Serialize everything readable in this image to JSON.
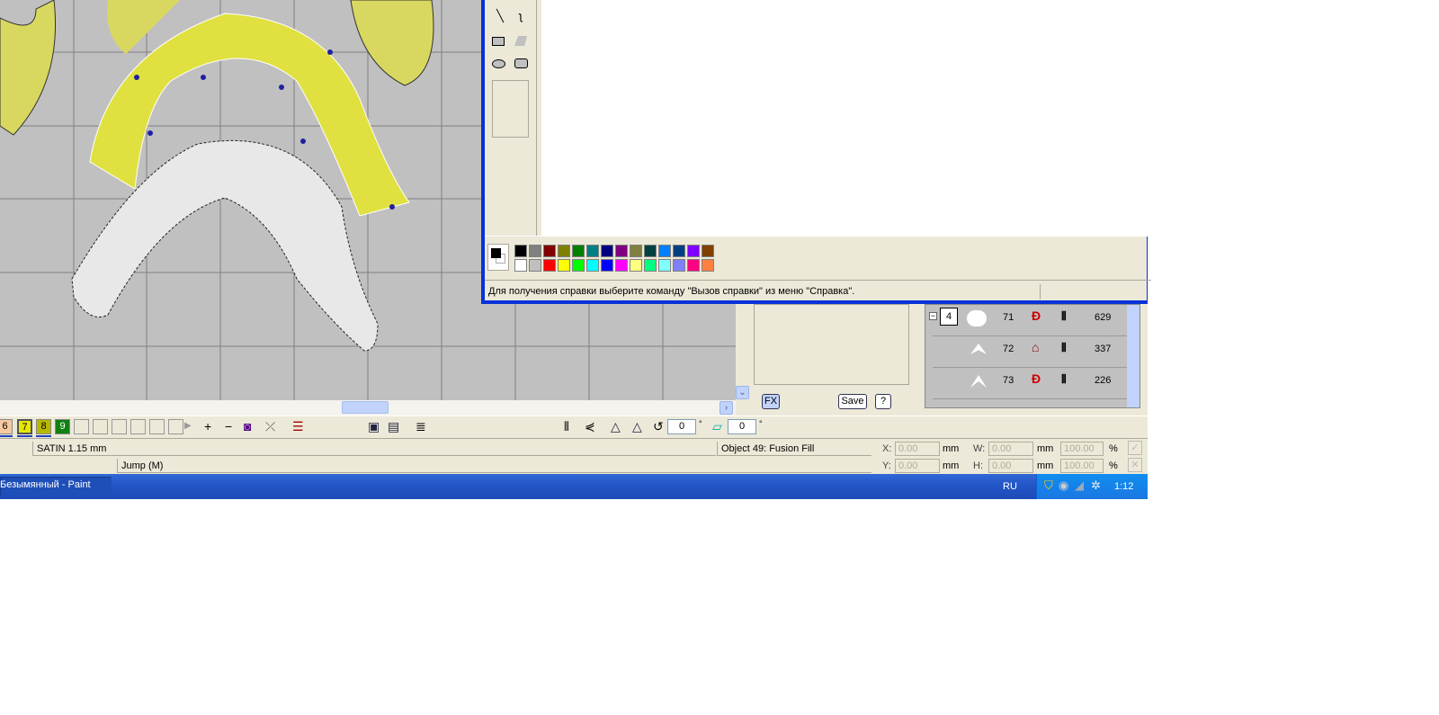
{
  "canvas": {
    "grid_color": "#808080",
    "background": "#c0c0c0"
  },
  "paint": {
    "status_text": "Для получения справки выберите команду \"Вызов справки\" из меню \"Справка\".",
    "palette_top": [
      "#000000",
      "#808080",
      "#800000",
      "#808000",
      "#008000",
      "#008080",
      "#000080",
      "#800080",
      "#808040",
      "#004040",
      "#0080ff",
      "#004080",
      "#8000ff",
      "#804000"
    ],
    "palette_bottom": [
      "#ffffff",
      "#c0c0c0",
      "#ff0000",
      "#ffff00",
      "#00ff00",
      "#00ffff",
      "#0000ff",
      "#ff00ff",
      "#ffff80",
      "#00ff80",
      "#80ffff",
      "#8080ff",
      "#ff0080",
      "#ff8040"
    ],
    "tools": [
      "line-tool",
      "curve-tool",
      "rectangle-tool",
      "polygon-tool",
      "ellipse-tool",
      "rounded-rectangle-tool"
    ]
  },
  "side_panel": {
    "fx_label": "FX",
    "save_label": "Save",
    "help_label": "?"
  },
  "object_list": {
    "group_number": "4",
    "rows": [
      {
        "id": "71",
        "stitches": "629"
      },
      {
        "id": "72",
        "stitches": "337"
      },
      {
        "id": "73",
        "stitches": "226"
      }
    ]
  },
  "color_swatches": [
    {
      "label": "6",
      "color": "#f8c8a0"
    },
    {
      "label": "7",
      "color": "#e8e800"
    },
    {
      "label": "8",
      "color": "#b8b800"
    },
    {
      "label": "9",
      "color": "#108010"
    }
  ],
  "toolbar": {
    "rotate_value": "0",
    "slant_value": "0",
    "degree": "°"
  },
  "status": {
    "stitch_type": "SATIN  1.15 mm",
    "jump": "Jump (M)",
    "object": "Object 49: Fusion Fill",
    "x_label": "X:",
    "y_label": "Y:",
    "w_label": "W:",
    "h_label": "H:",
    "x": "0.00",
    "y": "0.00",
    "w": "0.00",
    "h": "0.00",
    "unit": "mm",
    "sx": "100.00",
    "sy": "100.00",
    "pct": "%"
  },
  "taskbar": {
    "task": "Безымянный - Paint",
    "lang": "RU",
    "clock": "1:12"
  }
}
